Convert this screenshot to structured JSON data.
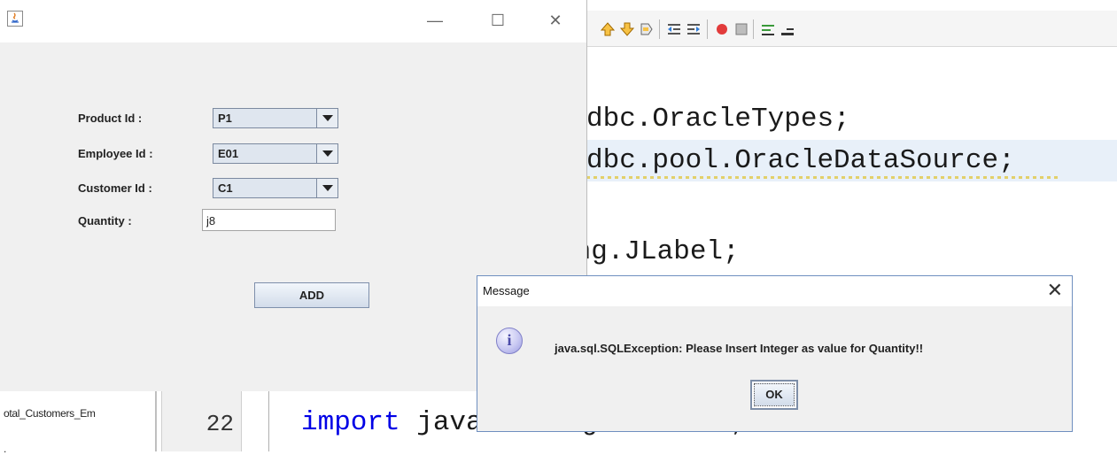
{
  "ide": {
    "toolbar_icons": [
      "bookmark-up-icon",
      "bookmark-down-icon",
      "bookmark-toggle-icon",
      "shift-left-icon",
      "shift-right-icon",
      "record-macro-icon",
      "stop-macro-icon",
      "comment-icon",
      "uncomment-icon"
    ],
    "code_lines": [
      {
        "text": "dbc.OracleTypes;"
      },
      {
        "text": "dbc.pool.OracleDataSource;"
      },
      {
        "text": "ing.JLabel;"
      }
    ],
    "partial_line_text": "import javax.swing.JButton;",
    "partial_line_keyword": "import",
    "partial_line_rest": " javax.swing.JButton;",
    "line_number": "22",
    "project_item": "otal_Customers_Em",
    "project_item_2": "."
  },
  "app": {
    "title": "",
    "window_controls": {
      "minimize": "—",
      "maximize": "☐",
      "close": "✕"
    },
    "fields": {
      "product": {
        "label": "Product Id :",
        "value": "P1"
      },
      "employee": {
        "label": "Employee Id :",
        "value": "E01"
      },
      "customer": {
        "label": "Customer Id :",
        "value": "C1"
      },
      "quantity": {
        "label": "Quantity :",
        "value": "j8"
      }
    },
    "add_label": "ADD"
  },
  "dialog": {
    "title": "Message",
    "close": "✕",
    "icon": "info-icon",
    "icon_glyph": "i",
    "message": "java.sql.SQLException: Please Insert Integer as value for Quantity!!",
    "ok_label": "OK"
  },
  "colors": {
    "ide_highlight": "#e8f0f9",
    "keyword": "#0000e6",
    "dialog_border": "#6f8fbf",
    "combo_bg": "#dfe6ef"
  }
}
